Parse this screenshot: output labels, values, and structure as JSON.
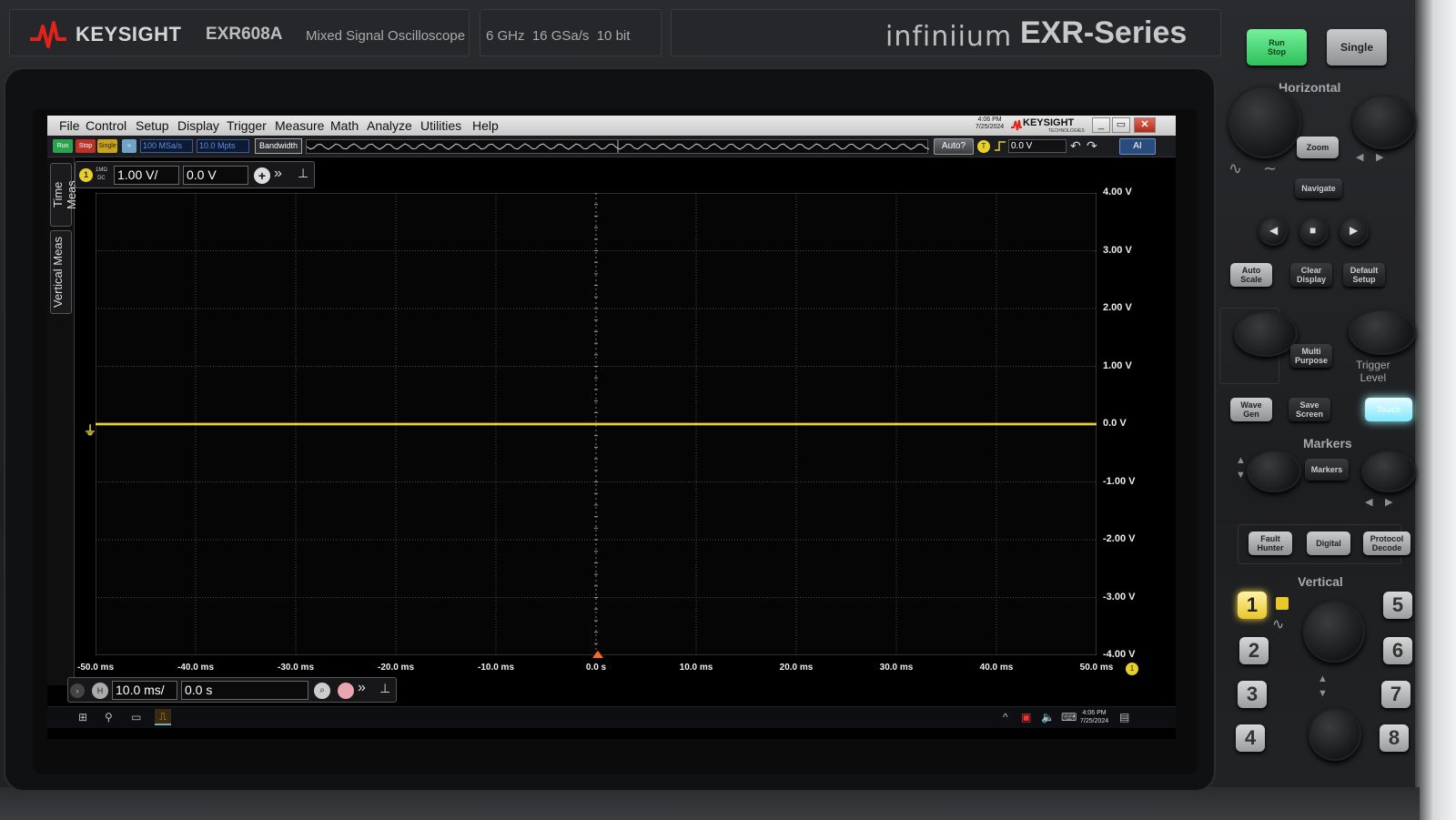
{
  "device": {
    "brand": "KEYSIGHT",
    "model": "EXR608A",
    "description": "Mixed Signal Oscilloscope",
    "specs": "6 GHz  16 GSa/s  10 bit",
    "series_word": "infiniium",
    "series_name": "EXR-Series"
  },
  "menu": [
    "File",
    "Control",
    "Setup",
    "Display",
    "Trigger",
    "Measure",
    "Math",
    "Analyze",
    "Utilities",
    "Help"
  ],
  "screen_header": {
    "time": "4:06 PM",
    "date": "7/25/2024",
    "logo": "KEYSIGHT",
    "logo_sub": "TECHNOLOGIES"
  },
  "toolbar": {
    "run": "Run",
    "stop": "Stop",
    "single": "Single",
    "sample_rate": "100 MSa/s",
    "memory_depth": "10.0 Mpts",
    "bandwidth": "Bandwidth",
    "auto": "Auto?",
    "trigger_channel": "T",
    "trigger_level": "0.0 V",
    "ai_button": "AI"
  },
  "side_tabs": [
    "Time Meas",
    "Vertical Meas"
  ],
  "channel": {
    "number": "1",
    "coupling_top": "1MΩ",
    "coupling_bottom": "DC",
    "scale": "1.00 V/",
    "offset": "0.0 V"
  },
  "y_axis_labels": [
    "4.00 V",
    "3.00 V",
    "2.00 V",
    "1.00 V",
    "0.0 V",
    "-1.00 V",
    "-2.00 V",
    "-3.00 V",
    "-4.00 V"
  ],
  "x_axis_labels": [
    "-50.0 ms",
    "-40.0 ms",
    "-30.0 ms",
    "-20.0 ms",
    "-10.0 ms",
    "0.0 s",
    "10.0 ms",
    "20.0 ms",
    "30.0 ms",
    "40.0 ms",
    "50.0 ms"
  ],
  "timebase": {
    "scale": "10.0 ms/",
    "delay": "0.0 s",
    "h_label": "H"
  },
  "taskbar": {
    "time": "4:06 PM",
    "date": "7/25/2024"
  },
  "trace": {
    "channel": "1",
    "level_volts": 0.0,
    "color": "#e8d72a"
  },
  "panel": {
    "run_stop": "Run\nStop",
    "single": "Single",
    "horizontal": "Horizontal",
    "zoom": "Zoom",
    "navigate": "Navigate",
    "auto_scale": "Auto\nScale",
    "clear_display": "Clear\nDisplay",
    "default_setup": "Default\nSetup",
    "multi_purpose": "Multi\nPurpose",
    "trigger_level": "Trigger\nLevel",
    "wave_gen": "Wave\nGen",
    "save_screen": "Save\nScreen",
    "touch": "Touch",
    "markers_title": "Markers",
    "markers_btn": "Markers",
    "fault_hunter": "Fault\nHunter",
    "digital": "Digital",
    "protocol_decode": "Protocol\nDecode",
    "vertical": "Vertical",
    "channels": [
      "1",
      "2",
      "3",
      "4",
      "5",
      "6",
      "7",
      "8"
    ]
  },
  "colors": {
    "channel1": "#e8d72a",
    "run_green": "#3bd46a",
    "stop_red": "#b93329",
    "trigger_marker": "#ff6a1e",
    "touch_cyan": "#7fe8ff"
  }
}
